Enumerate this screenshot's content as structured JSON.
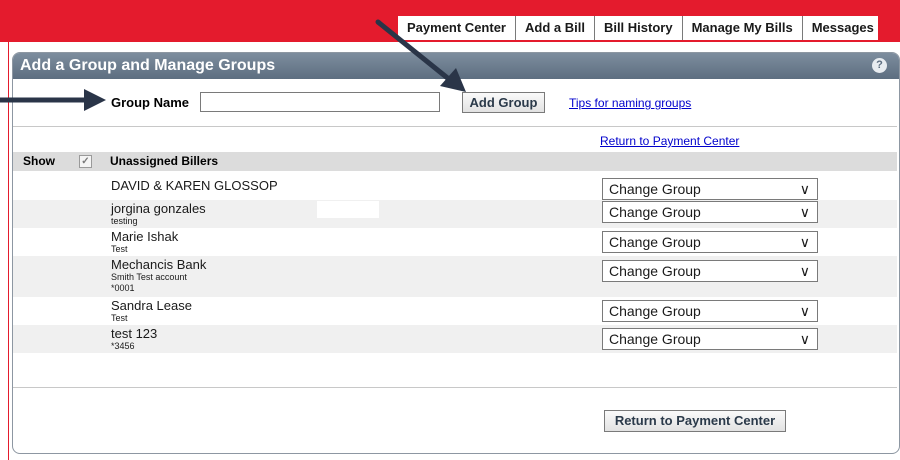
{
  "nav": {
    "tabs": [
      "Payment Center",
      "Add a Bill",
      "Bill History",
      "Manage My Bills",
      "Messages"
    ]
  },
  "panel": {
    "title": "Add a Group and Manage Groups",
    "help_icon": "?"
  },
  "group_form": {
    "label": "Group Name",
    "input_value": "",
    "add_button": "Add Group",
    "tips_link": "Tips for naming groups"
  },
  "return_link": "Return to Payment Center",
  "table": {
    "show_label": "Show",
    "show_checked": true,
    "column_title": "Unassigned Billers",
    "rows": [
      {
        "name": "DAVID & KAREN GLOSSOP",
        "sub1": "",
        "sub2": "",
        "select": "Change Group"
      },
      {
        "name": "jorgina gonzales",
        "sub1": "testing",
        "sub2": "",
        "select": "Change Group"
      },
      {
        "name": "Marie Ishak",
        "sub1": "Test",
        "sub2": "",
        "select": "Change Group"
      },
      {
        "name": "Mechancis Bank",
        "sub1": "Smith Test account",
        "sub2": "*0001",
        "select": "Change Group"
      },
      {
        "name": "Sandra Lease",
        "sub1": "Test",
        "sub2": "",
        "select": "Change Group"
      },
      {
        "name": "test 123",
        "sub1": "*3456",
        "sub2": "",
        "select": "Change Group"
      }
    ]
  },
  "return_button": "Return to Payment Center",
  "colors": {
    "brand_red": "#e41b2d",
    "header_slate": "#5d6e80",
    "link_blue": "#0000cc",
    "arrow_navy": "#2a3548"
  }
}
